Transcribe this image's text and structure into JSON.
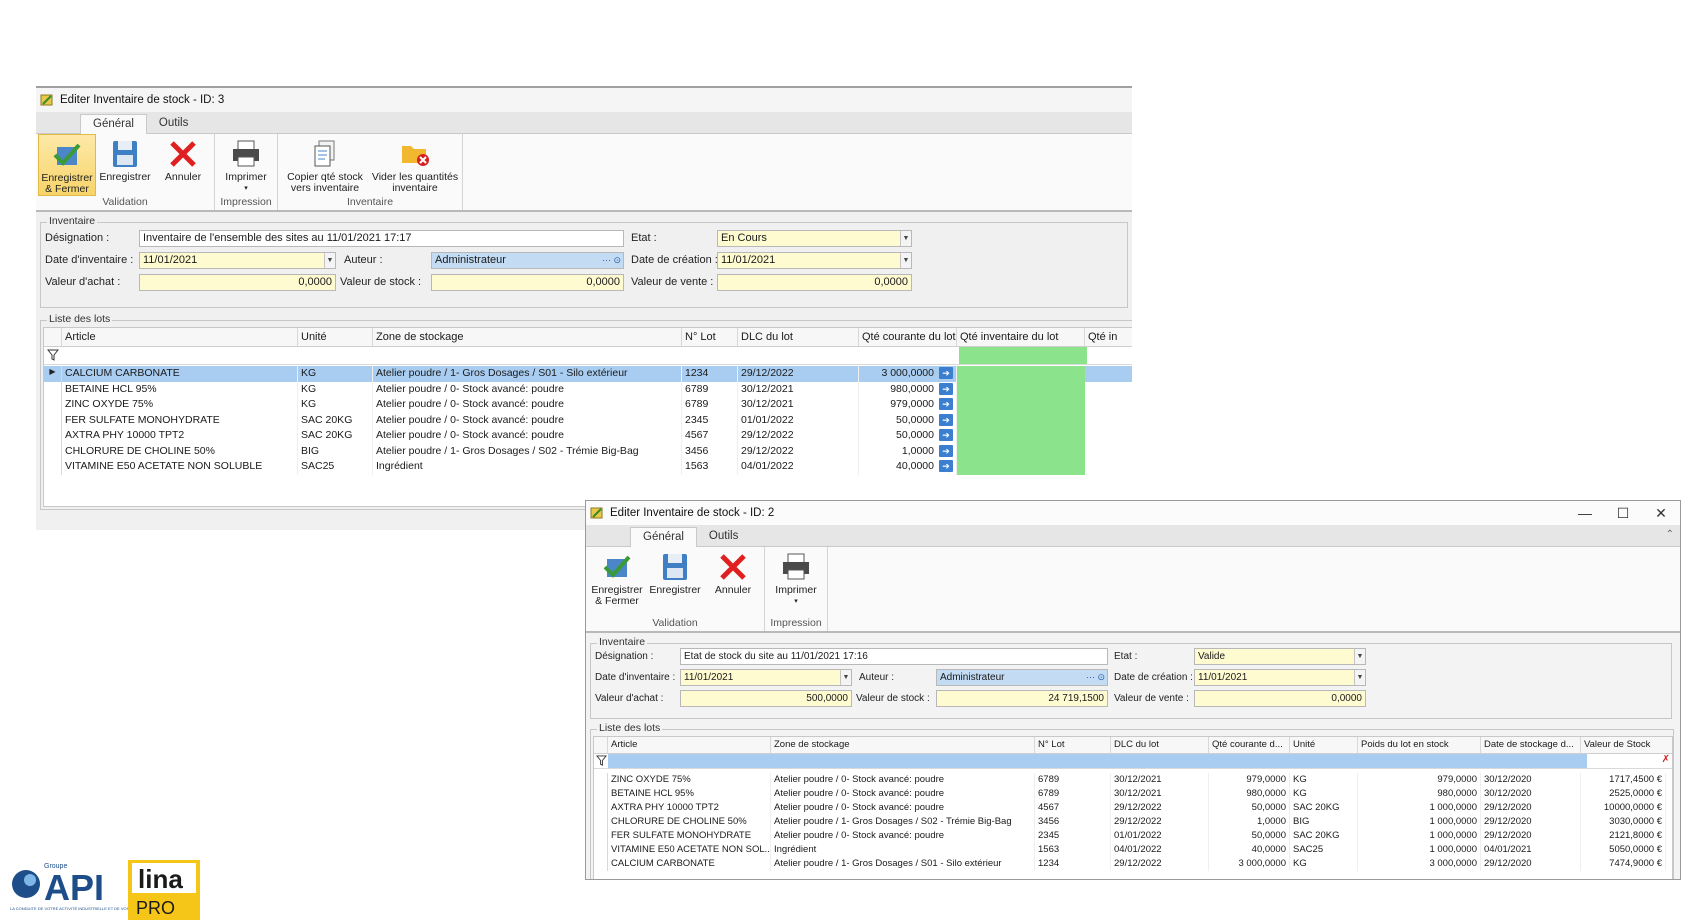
{
  "win1": {
    "title": "Editer Inventaire de stock - ID: 3",
    "tabs": [
      "Général",
      "Outils"
    ],
    "ribbon": {
      "save_close": "Enregistrer & Fermer",
      "save": "Enregistrer",
      "cancel": "Annuler",
      "print": "Imprimer",
      "copy_qty": "Copier qté stock vers inventaire",
      "clear_qty": "Vider les quantités inventaire",
      "group_validation": "Validation",
      "group_print": "Impression",
      "group_inventory": "Inventaire"
    },
    "form": {
      "legend": "Inventaire",
      "designation_label": "Désignation :",
      "designation": "Inventaire de l'ensemble des sites au 11/01/2021 17:17",
      "etat_label": "Etat :",
      "etat": "En Cours",
      "date_label": "Date d'inventaire :",
      "date": "11/01/2021",
      "auteur_label": "Auteur :",
      "auteur": "Administrateur",
      "creation_label": "Date de création :",
      "creation": "11/01/2021",
      "achat_label": "Valeur d'achat :",
      "achat": "0,0000",
      "stock_label": "Valeur de stock :",
      "stock": "0,0000",
      "vente_label": "Valeur de vente :",
      "vente": "0,0000"
    },
    "lots": {
      "legend": "Liste des lots",
      "headers": [
        "Article",
        "Unité",
        "Zone de stockage",
        "N° Lot",
        "DLC du lot",
        "Qté courante du lot",
        "Qté inventaire du lot",
        "Qté in"
      ],
      "rows": [
        [
          "CALCIUM CARBONATE",
          "KG",
          "Atelier poudre / 1- Gros Dosages / S01 - Silo extérieur",
          "1234",
          "29/12/2022",
          "3 000,0000"
        ],
        [
          "BETAINE HCL 95%",
          "KG",
          "Atelier poudre / 0- Stock avancé: poudre",
          "6789",
          "30/12/2021",
          "980,0000"
        ],
        [
          "ZINC OXYDE 75%",
          "KG",
          "Atelier poudre / 0- Stock avancé: poudre",
          "6789",
          "30/12/2021",
          "979,0000"
        ],
        [
          "FER SULFATE MONOHYDRATE",
          "SAC 20KG",
          "Atelier poudre / 0- Stock avancé: poudre",
          "2345",
          "01/01/2022",
          "50,0000"
        ],
        [
          "AXTRA PHY 10000 TPT2",
          "SAC 20KG",
          "Atelier poudre / 0- Stock avancé: poudre",
          "4567",
          "29/12/2022",
          "50,0000"
        ],
        [
          "CHLORURE DE CHOLINE 50%",
          "BIG",
          "Atelier poudre / 1- Gros Dosages / S02 - Trémie Big-Bag",
          "3456",
          "29/12/2022",
          "1,0000"
        ],
        [
          "VITAMINE E50 ACETATE NON SOLUBLE",
          "SAC25",
          "Ingrédient",
          "1563",
          "04/01/2022",
          "40,0000"
        ]
      ]
    }
  },
  "win2": {
    "title": "Editer Inventaire de stock - ID: 2",
    "controls": {
      "min": "—",
      "max": "☐",
      "close": "✕"
    },
    "tabs": [
      "Général",
      "Outils"
    ],
    "ribbon": {
      "save_close": "Enregistrer & Fermer",
      "save": "Enregistrer",
      "cancel": "Annuler",
      "print": "Imprimer",
      "group_validation": "Validation",
      "group_print": "Impression"
    },
    "form": {
      "legend": "Inventaire",
      "designation_label": "Désignation :",
      "designation": "Etat de stock du site au 11/01/2021 17:16",
      "etat_label": "Etat :",
      "etat": "Valide",
      "date_label": "Date d'inventaire :",
      "date": "11/01/2021",
      "auteur_label": "Auteur :",
      "auteur": "Administrateur",
      "creation_label": "Date de création :",
      "creation": "11/01/2021",
      "achat_label": "Valeur d'achat :",
      "achat": "500,0000",
      "stock_label": "Valeur de stock :",
      "stock": "24 719,1500",
      "vente_label": "Valeur de vente :",
      "vente": "0,0000"
    },
    "lots": {
      "legend": "Liste des lots",
      "headers": [
        "Article",
        "Zone de stockage",
        "N° Lot",
        "DLC du lot",
        "Qté courante d...",
        "Unité",
        "Poids du lot en stock",
        "Date de stockage d...",
        "Valeur de Stock"
      ],
      "rows": [
        [
          "ZINC OXYDE 75%",
          "Atelier poudre / 0- Stock avancé: poudre",
          "6789",
          "30/12/2021",
          "979,0000",
          "KG",
          "979,0000",
          "30/12/2020",
          "1717,4500 €"
        ],
        [
          "BETAINE HCL 95%",
          "Atelier poudre / 0- Stock avancé: poudre",
          "6789",
          "30/12/2021",
          "980,0000",
          "KG",
          "980,0000",
          "30/12/2020",
          "2525,0000 €"
        ],
        [
          "AXTRA PHY 10000 TPT2",
          "Atelier poudre / 0- Stock avancé: poudre",
          "4567",
          "29/12/2022",
          "50,0000",
          "SAC 20KG",
          "1 000,0000",
          "29/12/2020",
          "10000,0000 €"
        ],
        [
          "CHLORURE DE CHOLINE 50%",
          "Atelier poudre / 1- Gros Dosages / S02 - Trémie Big-Bag",
          "3456",
          "29/12/2022",
          "1,0000",
          "BIG",
          "1 000,0000",
          "29/12/2020",
          "3030,0000 €"
        ],
        [
          "FER SULFATE MONOHYDRATE",
          "Atelier poudre / 0- Stock avancé: poudre",
          "2345",
          "01/01/2022",
          "50,0000",
          "SAC 20KG",
          "1 000,0000",
          "29/12/2020",
          "2121,8000 €"
        ],
        [
          "VITAMINE E50 ACETATE NON SOL...",
          "Ingrédient",
          "1563",
          "04/01/2022",
          "40,0000",
          "SAC25",
          "1 000,0000",
          "04/01/2021",
          "5050,0000 €"
        ],
        [
          "CALCIUM CARBONATE",
          "Atelier poudre / 1- Gros Dosages / S01 - Silo extérieur",
          "1234",
          "29/12/2022",
          "3 000,0000",
          "KG",
          "3 000,0000",
          "29/12/2020",
          "7474,9000 €"
        ]
      ]
    }
  },
  "logo": {
    "group": "Groupe",
    "api": "API",
    "tagline": "LA CONDUITE DE VOTRE ACTIVITÉ INDUSTRIELLE ET DE VOS BÂTIMENTS",
    "lina": "lina",
    "pro": "PRO"
  },
  "colors": {
    "selected_row": "#a9cdf1",
    "input_yellow": "#fffbd1",
    "inventory_green": "#8be48b",
    "cancel_red": "#e02020"
  }
}
